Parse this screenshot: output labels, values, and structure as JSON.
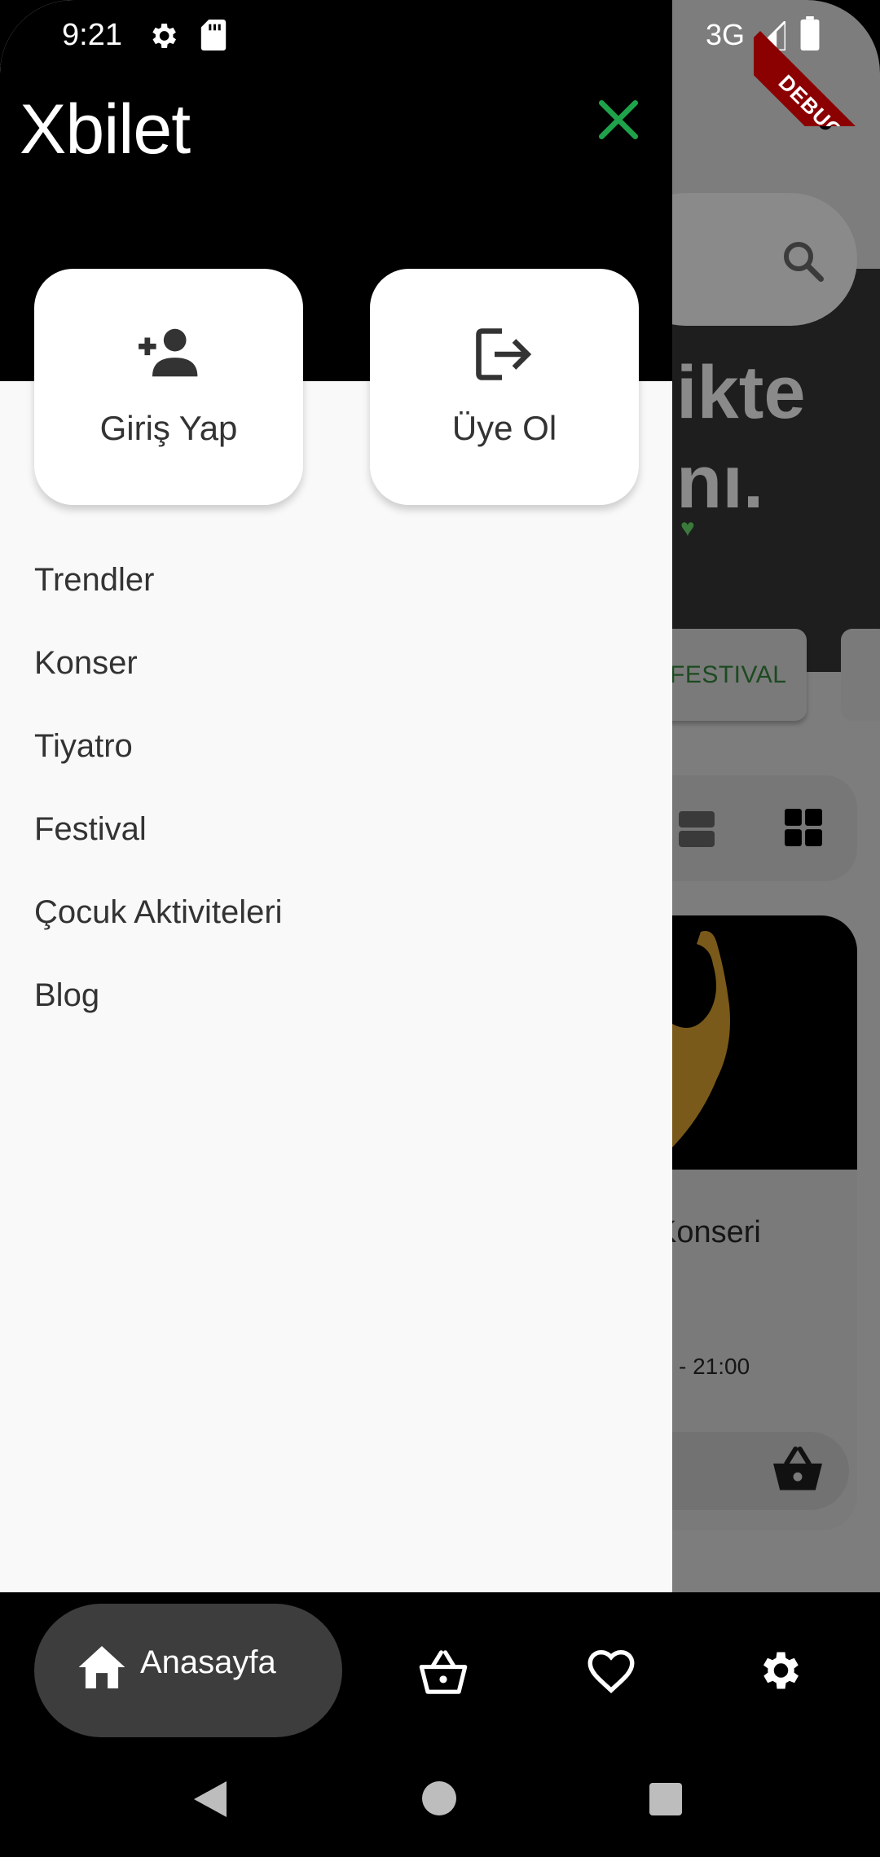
{
  "status_bar": {
    "time": "9:21",
    "network": "3G",
    "debug_banner": "DEBUG"
  },
  "app": {
    "title": "Xbilet"
  },
  "auth": {
    "login_label": "Giriş Yap",
    "register_label": "Üye Ol"
  },
  "menu": {
    "items": [
      {
        "label": "Trendler"
      },
      {
        "label": "Konser"
      },
      {
        "label": "Tiyatro"
      },
      {
        "label": "Festival"
      },
      {
        "label": "Çocuk Aktiviteleri"
      },
      {
        "label": "Blog"
      }
    ]
  },
  "background": {
    "hero_text_line1": "ikte",
    "hero_text_line2": "nı.",
    "tab_label": "FESTIVAL",
    "card_title": "Konseri",
    "card_time": "- 21:00"
  },
  "bottom_nav": {
    "home_label": "Anasayfa"
  },
  "colors": {
    "accent_green": "#1fa34a",
    "drawer_bg": "#f9f9f9",
    "nav_pill": "#3d3d3d"
  },
  "icons": {
    "close": "close-icon",
    "location": "location-pin-icon",
    "search": "search-icon",
    "login": "person-add-icon",
    "register": "logout-icon",
    "home": "home-icon",
    "basket": "basket-icon",
    "favorites": "heart-icon",
    "settings": "gear-icon"
  }
}
